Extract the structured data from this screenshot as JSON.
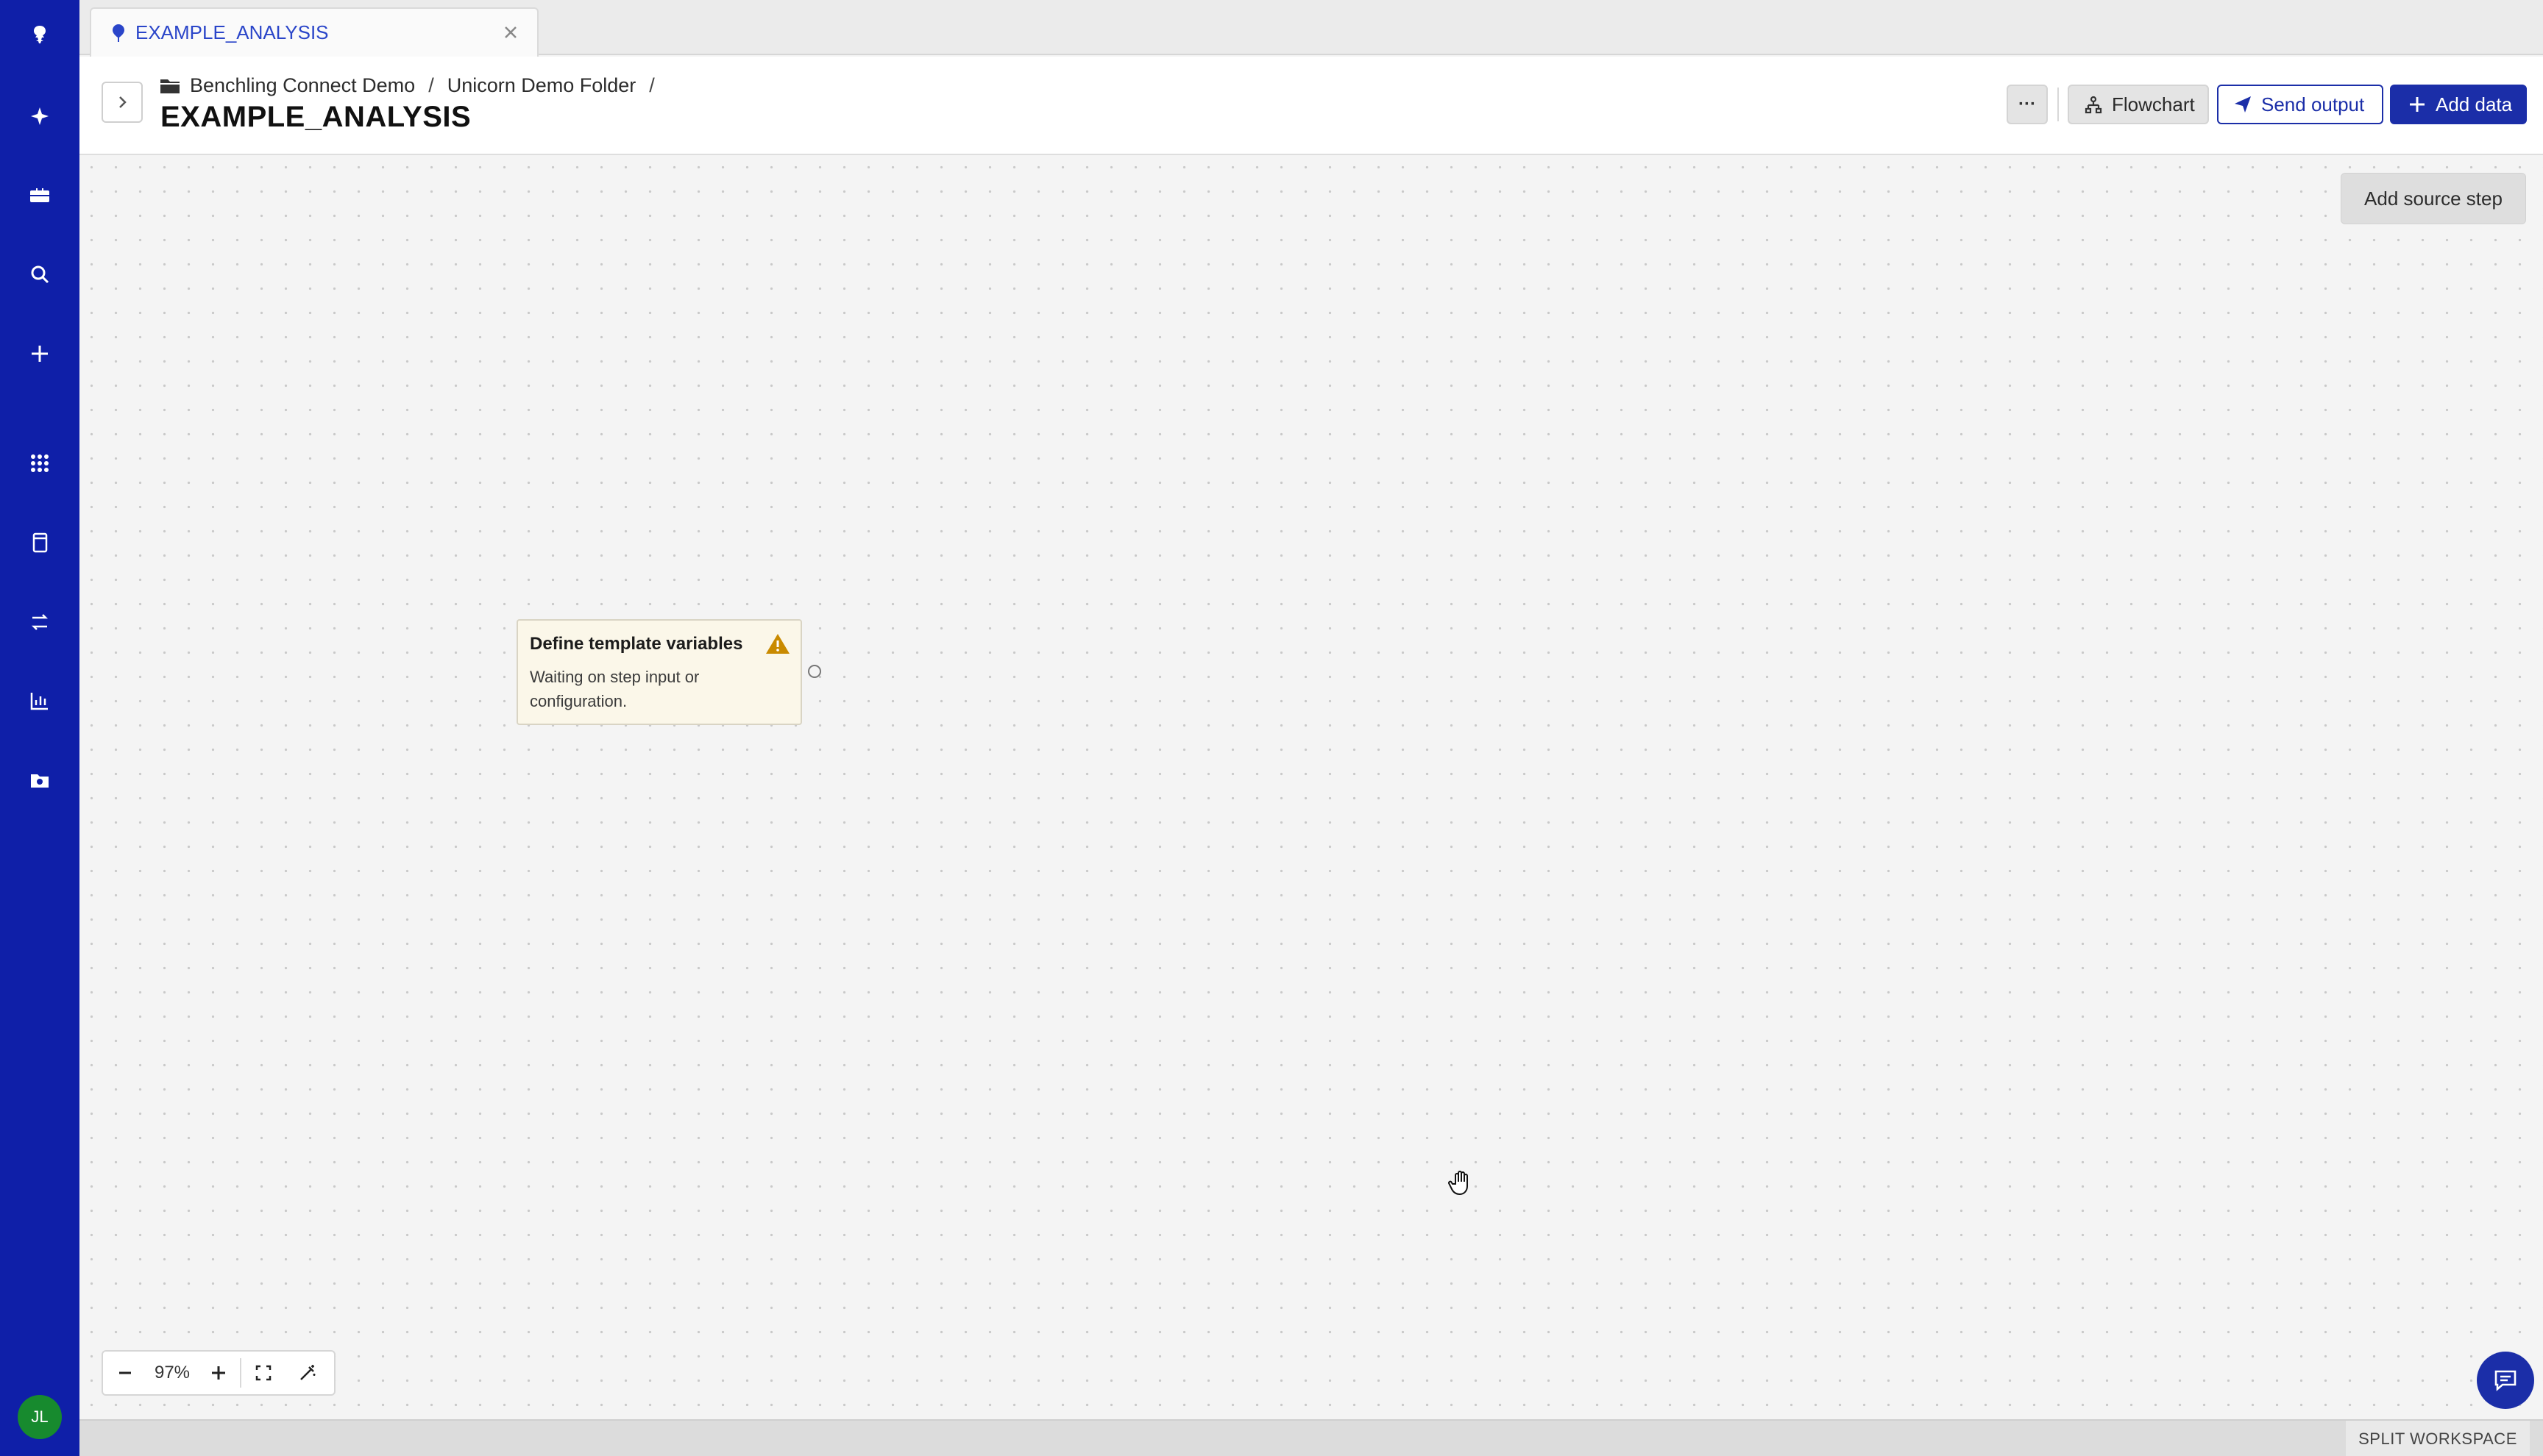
{
  "tab": {
    "title": "EXAMPLE_ANALYSIS"
  },
  "breadcrumb": {
    "items": [
      "Benchling Connect Demo",
      "Unicorn Demo Folder"
    ],
    "separator": "/"
  },
  "page": {
    "title": "EXAMPLE_ANALYSIS"
  },
  "toolbar": {
    "more_label": "···",
    "flowchart_label": "Flowchart",
    "send_output_label": "Send output",
    "add_data_label": "Add data"
  },
  "canvas": {
    "add_source_step_label": "Add source step",
    "node": {
      "title": "Define template variables",
      "description": "Waiting on step input or configuration.",
      "status": "warning"
    }
  },
  "zoom": {
    "value": "97%"
  },
  "user": {
    "initials": "JL"
  },
  "footer": {
    "split_workspace_label": "SPLIT WORKSPACE"
  },
  "sidebar": {
    "icons": [
      "benchling-logo-icon",
      "sparkle-icon",
      "briefcase-icon",
      "search-icon",
      "plus-icon",
      "apps-grid-icon",
      "notebook-icon",
      "workflow-icon",
      "chart-icon",
      "folder-camera-icon"
    ]
  },
  "colors": {
    "sidebar": "#0f1fa8",
    "primary": "#1b2ea8",
    "warning": "#c98a00",
    "node_bg": "#fbf7e9",
    "avatar": "#178a2e"
  }
}
